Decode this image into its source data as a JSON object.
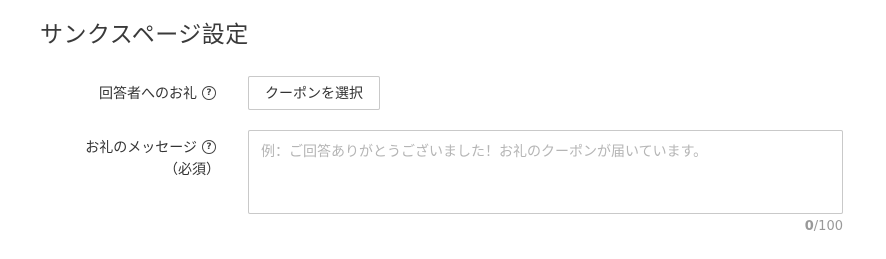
{
  "section": {
    "title": "サンクスページ設定"
  },
  "coupon": {
    "label": "回答者へのお礼",
    "help_icon": "question-circle-icon",
    "button_label": "クーポンを選択"
  },
  "message": {
    "label": "お礼のメッセージ",
    "help_icon": "question-circle-icon",
    "required_label": "（必須）",
    "value": "",
    "placeholder": "例：ご回答ありがとうございました！お礼のクーポンが届いています。",
    "char_count": "0",
    "char_limit": "/100"
  },
  "colors": {
    "border": "#c9c9c9",
    "placeholder": "#b5b5b5",
    "counter": "#999999"
  }
}
